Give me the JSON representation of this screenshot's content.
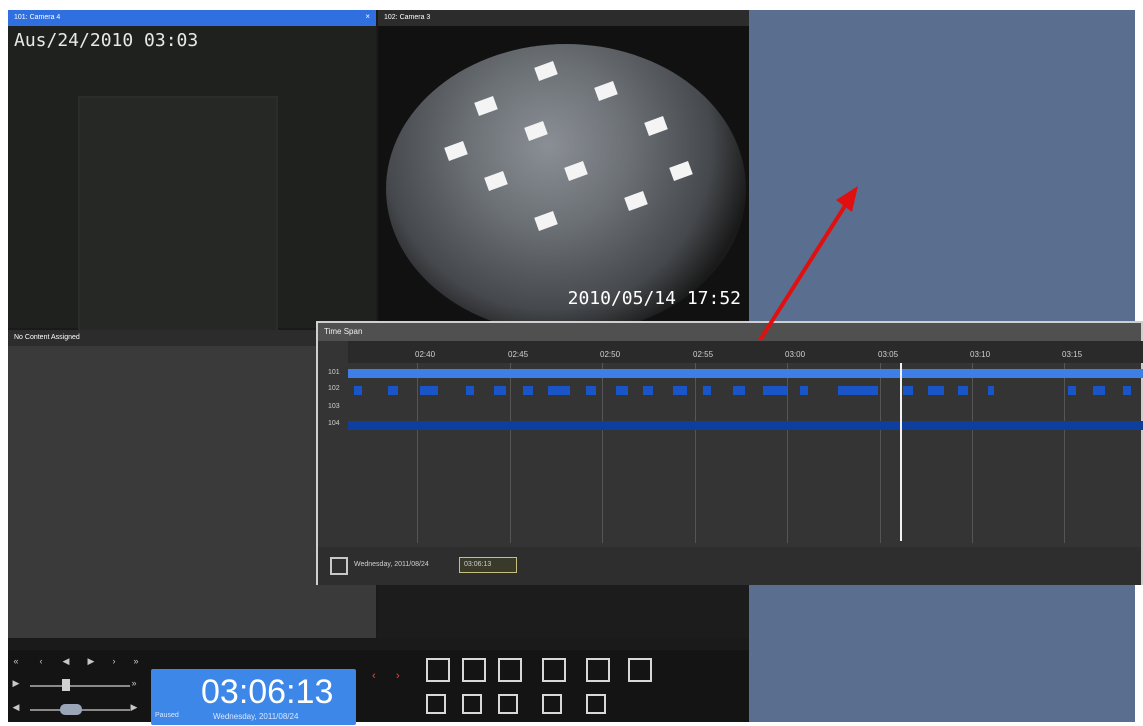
{
  "cameras": {
    "cam1": {
      "title": "101: Camera 4",
      "close": "×",
      "timestamp": "Aus/24/2010 03:03"
    },
    "cam2": {
      "title": "102: Camera 3",
      "timestamp": "2010/05/14 17:52"
    },
    "cam3": {
      "title": "No Content Assigned"
    }
  },
  "controls": {
    "time": "03:06:13",
    "status": "Paused",
    "date": "Wednesday, 2011/08/24",
    "nav_glyphs": [
      "«",
      "‹",
      "◀",
      "▶",
      "›",
      "»"
    ],
    "arrow_left": "‹",
    "arrow_right": "›"
  },
  "timespan": {
    "title": "Time Span",
    "ticks": [
      "02:40",
      "02:45",
      "02:50",
      "02:55",
      "03:00",
      "03:05",
      "03:10",
      "03:15"
    ],
    "rows": [
      "101",
      "102",
      "103",
      "104"
    ],
    "footer_date": "Wednesday, 2011/08/24",
    "footer_time": "03:06:13"
  },
  "icons": [
    "fullscreen-icon",
    "swap-icon",
    "single-view-icon",
    "quad-view-icon",
    "nine-view-icon",
    "custom-layout-icon",
    "export-icon",
    "record-icon",
    "clip-icon",
    "snapshot-icon",
    "trash-icon",
    "calendar-icon"
  ],
  "colors": {
    "accent": "#3c87e8",
    "track": "#1a55c8",
    "panel": "#5a6f8f",
    "arrow": "#e01010"
  }
}
